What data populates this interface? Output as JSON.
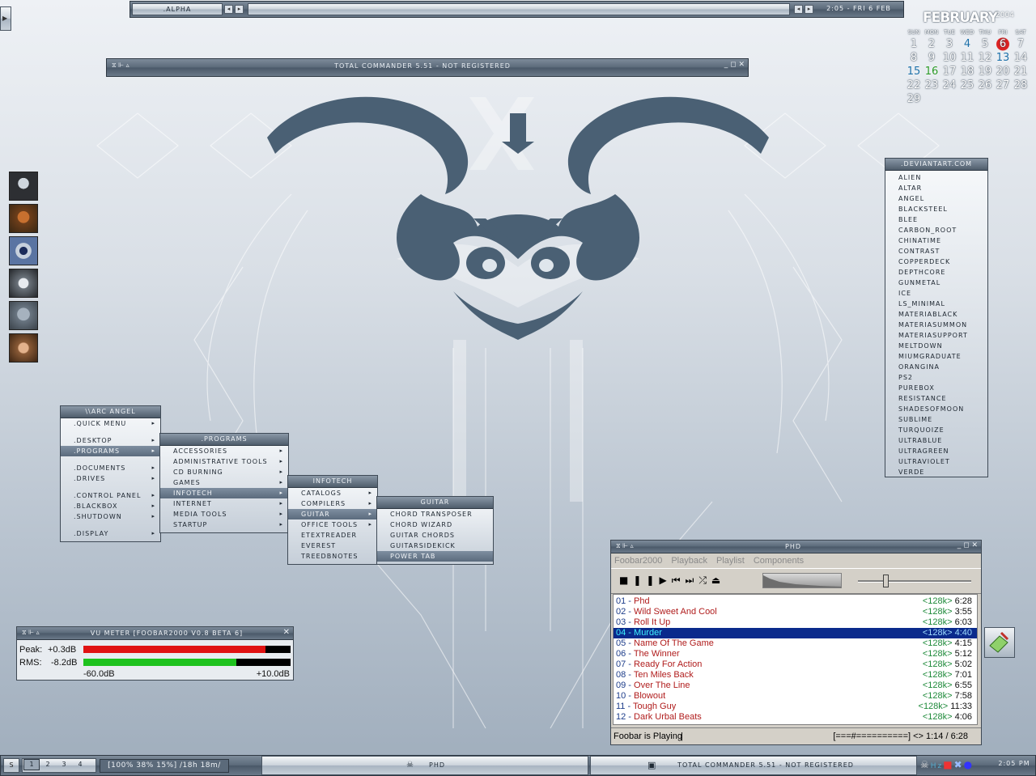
{
  "top_bar": {
    "workspace_label": ".ALPHA",
    "clock_date": "2:05 - FRI 6 FEB"
  },
  "calendar": {
    "month": "FEBRUARY",
    "year": "2004",
    "weekdays": [
      "SUN",
      "MON",
      "TUE",
      "WED",
      "THU",
      "FRI",
      "SAT"
    ],
    "weeks": [
      [
        "1",
        "2",
        "3",
        "4",
        "5",
        "6",
        "7"
      ],
      [
        "8",
        "9",
        "10",
        "11",
        "12",
        "13",
        "14"
      ],
      [
        "15",
        "16",
        "17",
        "18",
        "19",
        "20",
        "21"
      ],
      [
        "22",
        "23",
        "24",
        "25",
        "26",
        "27",
        "28"
      ],
      [
        "29",
        "",
        "",
        "",
        "",
        "",
        ""
      ]
    ],
    "today": "6",
    "highlight_blue": [
      "4",
      "13",
      "15"
    ],
    "highlight_green": [
      "16"
    ]
  },
  "total_commander": {
    "title": "TOTAL COMMANDER 5.51 - NOT REGISTERED"
  },
  "deviant": {
    "title": ".DEVIANTART.COM",
    "items": [
      "ALIEN",
      "ALTAR",
      "ANGEL",
      "BLACKSTEEL",
      "BLEE",
      "CARBON_ROOT",
      "CHINATIME",
      "CONTRAST",
      "COPPERDECK",
      "DEPTHCORE",
      "GUNMETAL",
      "ICE",
      "LS_MINIMAL",
      "MATERIABLACK",
      "MATERIASUMMON",
      "MATERIASUPPORT",
      "MELTDOWN",
      "MIUMGRADUATE",
      "ORANGINA",
      "PS2",
      "PUREBOX",
      "RESISTANCE",
      "SHADESOFMOON",
      "SUBLIME",
      "TURQUOIZE",
      "ULTRABLUE",
      "ULTRAGREEN",
      "ULTRAVIOLET",
      "VERDE"
    ]
  },
  "menus": {
    "root": {
      "title": "\\\\ARC ANGEL",
      "items": [
        {
          "label": ".QUICK MENU",
          "sub": true
        },
        {
          "label": ".DESKTOP",
          "sub": true,
          "gap": true
        },
        {
          "label": ".PROGRAMS",
          "sub": true,
          "sel": true
        },
        {
          "label": ".DOCUMENTS",
          "sub": true,
          "gap": true
        },
        {
          "label": ".DRIVES",
          "sub": true
        },
        {
          "label": ".CONTROL PANEL",
          "sub": true,
          "gap": true
        },
        {
          "label": ".BLACKBOX",
          "sub": true
        },
        {
          "label": ".SHUTDOWN",
          "sub": true
        },
        {
          "label": ".DISPLAY",
          "sub": true,
          "gap": true
        }
      ]
    },
    "programs": {
      "title": ".PROGRAMS",
      "items": [
        {
          "label": "ACCESSORIES",
          "sub": true
        },
        {
          "label": "ADMINISTRATIVE TOOLS",
          "sub": true
        },
        {
          "label": "CD BURNING",
          "sub": true
        },
        {
          "label": "GAMES",
          "sub": true
        },
        {
          "label": "INFOTECH",
          "sub": true,
          "sel": true
        },
        {
          "label": "INTERNET",
          "sub": true
        },
        {
          "label": "MEDIA TOOLS",
          "sub": true
        },
        {
          "label": "STARTUP",
          "sub": true
        }
      ]
    },
    "infotech": {
      "title": "INFOTECH",
      "items": [
        {
          "label": "CATALOGS",
          "sub": true
        },
        {
          "label": "COMPILERS",
          "sub": true
        },
        {
          "label": "GUITAR",
          "sub": true,
          "sel": true
        },
        {
          "label": "OFFICE TOOLS",
          "sub": true
        },
        {
          "label": "ETEXTREADER",
          "sub": false
        },
        {
          "label": "EVEREST",
          "sub": false
        },
        {
          "label": "TREEDBNOTES",
          "sub": false
        }
      ]
    },
    "guitar": {
      "title": "GUITAR",
      "items": [
        {
          "label": "CHORD TRANSPOSER",
          "sub": false
        },
        {
          "label": "CHORD WIZARD",
          "sub": false
        },
        {
          "label": "GUITAR CHORDS",
          "sub": false
        },
        {
          "label": "GUITARSIDEKICK",
          "sub": false
        },
        {
          "label": "POWER TAB",
          "sub": false,
          "sel": true
        }
      ]
    }
  },
  "vu_meter": {
    "title": "VU METER [FOOBAR2000 V0.8 BETA 6]",
    "peak_label": "Peak:",
    "peak_value": "+0.3dB",
    "peak_level": 0.88,
    "rms_label": "RMS:",
    "rms_value": "-8.2dB",
    "rms_level": 0.74,
    "scale_min": "-60.0dB",
    "scale_max": "+10.0dB",
    "peak_color": "#e01212",
    "rms_color": "#1ec21e"
  },
  "foobar": {
    "title": "PHD",
    "menu": [
      "Foobar2000",
      "Playback",
      "Playlist",
      "Components"
    ],
    "tracks": [
      {
        "num": "01",
        "title": "Phd",
        "bitrate": "<128k>",
        "time": "6:28"
      },
      {
        "num": "02",
        "title": "Wild Sweet And Cool",
        "bitrate": "<128k>",
        "time": "3:55"
      },
      {
        "num": "03",
        "title": "Roll It Up",
        "bitrate": "<128k>",
        "time": "6:03"
      },
      {
        "num": "04",
        "title": "Murder",
        "bitrate": "<128k>",
        "time": "4:40",
        "sel": true
      },
      {
        "num": "05",
        "title": "Name Of The Game",
        "bitrate": "<128k>",
        "time": "4:15"
      },
      {
        "num": "06",
        "title": "The Winner",
        "bitrate": "<128k>",
        "time": "5:12"
      },
      {
        "num": "07",
        "title": "Ready For Action",
        "bitrate": "<128k>",
        "time": "5:02"
      },
      {
        "num": "08",
        "title": "Ten Miles Back",
        "bitrate": "<128k>",
        "time": "7:01"
      },
      {
        "num": "09",
        "title": "Over The Line",
        "bitrate": "<128k>",
        "time": "6:55"
      },
      {
        "num": "10",
        "title": "Blowout",
        "bitrate": "<128k>",
        "time": "7:58"
      },
      {
        "num": "11",
        "title": "Tough Guy",
        "bitrate": "<128k>",
        "time": "11:33"
      },
      {
        "num": "12",
        "title": "Dark Urbal Beats",
        "bitrate": "<128k>",
        "time": "4:06"
      }
    ],
    "status_left": "Foobar is Playing",
    "status_right": "[===#==========] <> 1:14 / 6:28",
    "volume_level": 0.22
  },
  "taskbar": {
    "workspaces": [
      "1",
      "2",
      "3",
      "4"
    ],
    "stats": "[100% 38% 15%] /18h 18m/",
    "tasks": [
      "PHD",
      "TOTAL COMMANDER 5.51 - NOT REGISTERED"
    ],
    "clock": "2:05 PM"
  },
  "left_icons": [
    "skull-avatar-icon",
    "orc-avatar-icon",
    "eye-emblem-icon",
    "wolf-avatar-icon",
    "robot-avatar-icon",
    "girl-avatar-icon"
  ]
}
